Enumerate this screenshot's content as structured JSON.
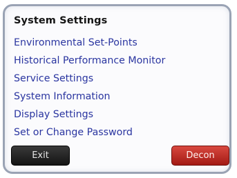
{
  "screen": {
    "title": "System Settings"
  },
  "menu": {
    "items": [
      {
        "label": "Environmental Set-Points"
      },
      {
        "label": "Historical Performance Monitor"
      },
      {
        "label": "Service Settings"
      },
      {
        "label": "System Information"
      },
      {
        "label": "Display Settings"
      },
      {
        "label": "Set or Change Password"
      }
    ],
    "link_color": "#2a35a0"
  },
  "buttons": {
    "exit_label": "Exit",
    "decon_label": "Decon",
    "exit_color": "#1c1c1c",
    "decon_color": "#c0302a"
  }
}
